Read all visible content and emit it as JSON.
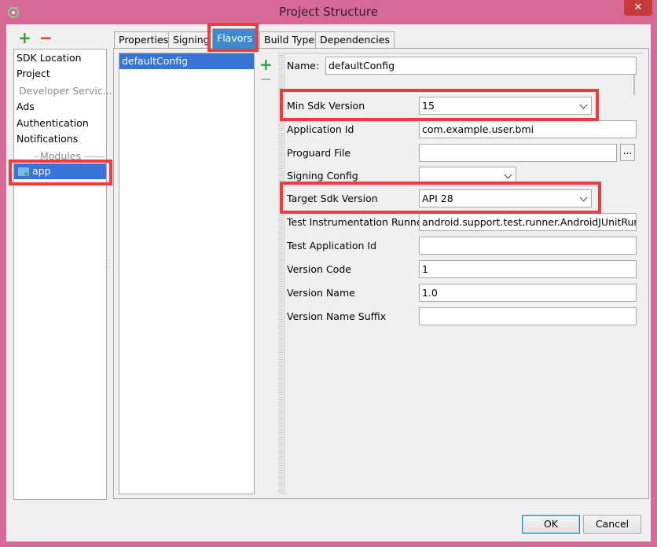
{
  "window": {
    "title": "Project Structure",
    "close_glyph": "✕"
  },
  "left_toolbar": {
    "add_icon": "+",
    "remove_icon": "−"
  },
  "nav": {
    "items": [
      {
        "label": "SDK Location",
        "enabled": true
      },
      {
        "label": "Project",
        "enabled": true
      },
      {
        "label": "Developer Servic...",
        "enabled": false
      },
      {
        "label": "Ads",
        "enabled": true
      },
      {
        "label": "Authentication",
        "enabled": true
      },
      {
        "label": "Notifications",
        "enabled": true
      }
    ],
    "modules_header": "Modules",
    "modules": [
      {
        "label": "app",
        "selected": true
      }
    ]
  },
  "tabs": [
    {
      "label": "Properties",
      "active": false
    },
    {
      "label": "Signing",
      "active": false
    },
    {
      "label": "Flavors",
      "active": true
    },
    {
      "label": "Build Types",
      "active": false
    },
    {
      "label": "Dependencies",
      "active": false
    }
  ],
  "flavors": {
    "list": [
      {
        "label": "defaultConfig",
        "selected": true
      }
    ],
    "add_icon": "+"
  },
  "form": {
    "name_label": "Name:",
    "name_value": "defaultConfig",
    "min_sdk": {
      "label": "Min Sdk Version",
      "value": "15"
    },
    "application_id": {
      "label": "Application Id",
      "value": "com.example.user.bmi"
    },
    "proguard_file": {
      "label": "Proguard File",
      "value": "",
      "browse": "..."
    },
    "signing_config": {
      "label": "Signing Config",
      "value": ""
    },
    "target_sdk": {
      "label": "Target Sdk Version",
      "value": "API 28"
    },
    "test_runner": {
      "label": "Test Instrumentation Runner",
      "value": "android.support.test.runner.AndroidJUnitRunner"
    },
    "test_app_id": {
      "label": "Test Application Id",
      "value": ""
    },
    "version_code": {
      "label": "Version Code",
      "value": "1"
    },
    "version_name": {
      "label": "Version Name",
      "value": "1.0"
    },
    "version_name_suffix": {
      "label": "Version Name Suffix",
      "value": ""
    }
  },
  "buttons": {
    "ok": "OK",
    "cancel": "Cancel"
  },
  "colors": {
    "highlight": "#ec3c3c",
    "selection": "#3875d7",
    "titlebar": "#d56a98"
  }
}
